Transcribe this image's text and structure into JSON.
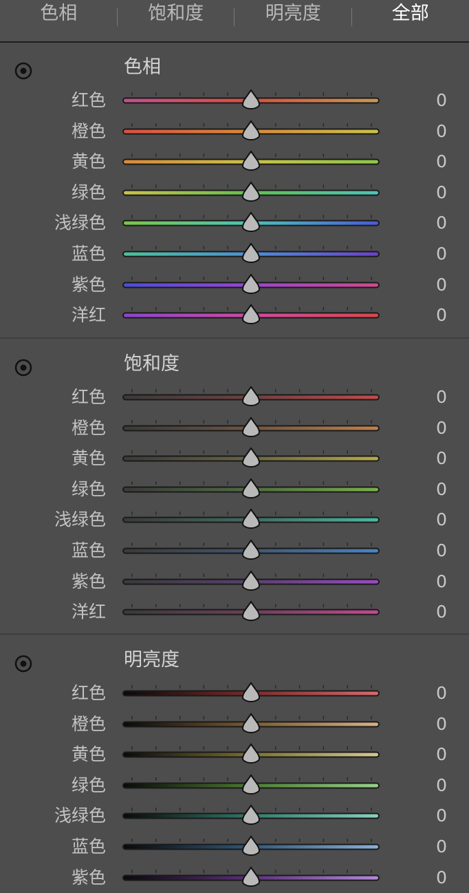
{
  "tabs": [
    {
      "label": "色相",
      "active": false
    },
    {
      "label": "饱和度",
      "active": false
    },
    {
      "label": "明亮度",
      "active": false
    },
    {
      "label": "全部",
      "active": true
    }
  ],
  "sections": [
    {
      "id": "hue",
      "title": "色相",
      "sliders": [
        {
          "label": "红色",
          "value": "0",
          "gradient": [
            "#c4508f",
            "#d9503f",
            "#c59a54"
          ]
        },
        {
          "label": "橙色",
          "value": "0",
          "gradient": [
            "#d9503f",
            "#d98a3a",
            "#c9c24a"
          ]
        },
        {
          "label": "黄色",
          "value": "0",
          "gradient": [
            "#d98a3a",
            "#c9c24a",
            "#8cc74a"
          ]
        },
        {
          "label": "绿色",
          "value": "0",
          "gradient": [
            "#c9c24a",
            "#62c052",
            "#4cc3b9"
          ]
        },
        {
          "label": "浅绿色",
          "value": "0",
          "gradient": [
            "#7cc748",
            "#4cc3b9",
            "#4a5bd6"
          ]
        },
        {
          "label": "蓝色",
          "value": "0",
          "gradient": [
            "#4cc29a",
            "#4d8fd6",
            "#6a42c9"
          ]
        },
        {
          "label": "紫色",
          "value": "0",
          "gradient": [
            "#4a4fd6",
            "#9a45d0",
            "#d04a8c"
          ]
        },
        {
          "label": "洋红",
          "value": "0",
          "gradient": [
            "#8a45d0",
            "#d04aa0",
            "#d8484c"
          ]
        }
      ]
    },
    {
      "id": "saturation",
      "title": "饱和度",
      "sliders": [
        {
          "label": "红色",
          "value": "0",
          "gradient": [
            "#3a3a3a",
            "#6e4040",
            "#c24a4a"
          ]
        },
        {
          "label": "橙色",
          "value": "0",
          "gradient": [
            "#3a3a3a",
            "#6e5540",
            "#c2804a"
          ]
        },
        {
          "label": "黄色",
          "value": "0",
          "gradient": [
            "#3a3a3a",
            "#6a6440",
            "#b8aa48"
          ]
        },
        {
          "label": "绿色",
          "value": "0",
          "gradient": [
            "#3a3a3a",
            "#4e6a40",
            "#78b048"
          ]
        },
        {
          "label": "浅绿色",
          "value": "0",
          "gradient": [
            "#3a3a3a",
            "#406a60",
            "#4ab8a2"
          ]
        },
        {
          "label": "蓝色",
          "value": "0",
          "gradient": [
            "#3a3a3a",
            "#40566e",
            "#4a84c2"
          ]
        },
        {
          "label": "紫色",
          "value": "0",
          "gradient": [
            "#3a3a3a",
            "#58406e",
            "#9a4ac2"
          ]
        },
        {
          "label": "洋红",
          "value": "0",
          "gradient": [
            "#3a3a3a",
            "#6a405a",
            "#c24a92"
          ]
        }
      ]
    },
    {
      "id": "luminance",
      "title": "明亮度",
      "sliders": [
        {
          "label": "红色",
          "value": "0",
          "gradient": [
            "#0a0a0a",
            "#7a2a2a",
            "#d86a6a"
          ]
        },
        {
          "label": "橙色",
          "value": "0",
          "gradient": [
            "#0a0a0a",
            "#7a5a30",
            "#d8b088"
          ]
        },
        {
          "label": "黄色",
          "value": "0",
          "gradient": [
            "#0a0a0a",
            "#7a7030",
            "#d8c890"
          ]
        },
        {
          "label": "绿色",
          "value": "0",
          "gradient": [
            "#0a0a0a",
            "#4a7a30",
            "#98d08a"
          ]
        },
        {
          "label": "浅绿色",
          "value": "0",
          "gradient": [
            "#0a0a0a",
            "#307a6a",
            "#8ad0c0"
          ]
        },
        {
          "label": "蓝色",
          "value": "0",
          "gradient": [
            "#0a0a0a",
            "#30587a",
            "#8ab0d8"
          ]
        },
        {
          "label": "紫色",
          "value": "0",
          "gradient": [
            "#0a0a0a",
            "#5a307a",
            "#b088d8"
          ]
        }
      ]
    }
  ],
  "icons": {
    "section_target": "target-adjustment-icon",
    "slider_thumb": "slider-thumb-icon"
  }
}
